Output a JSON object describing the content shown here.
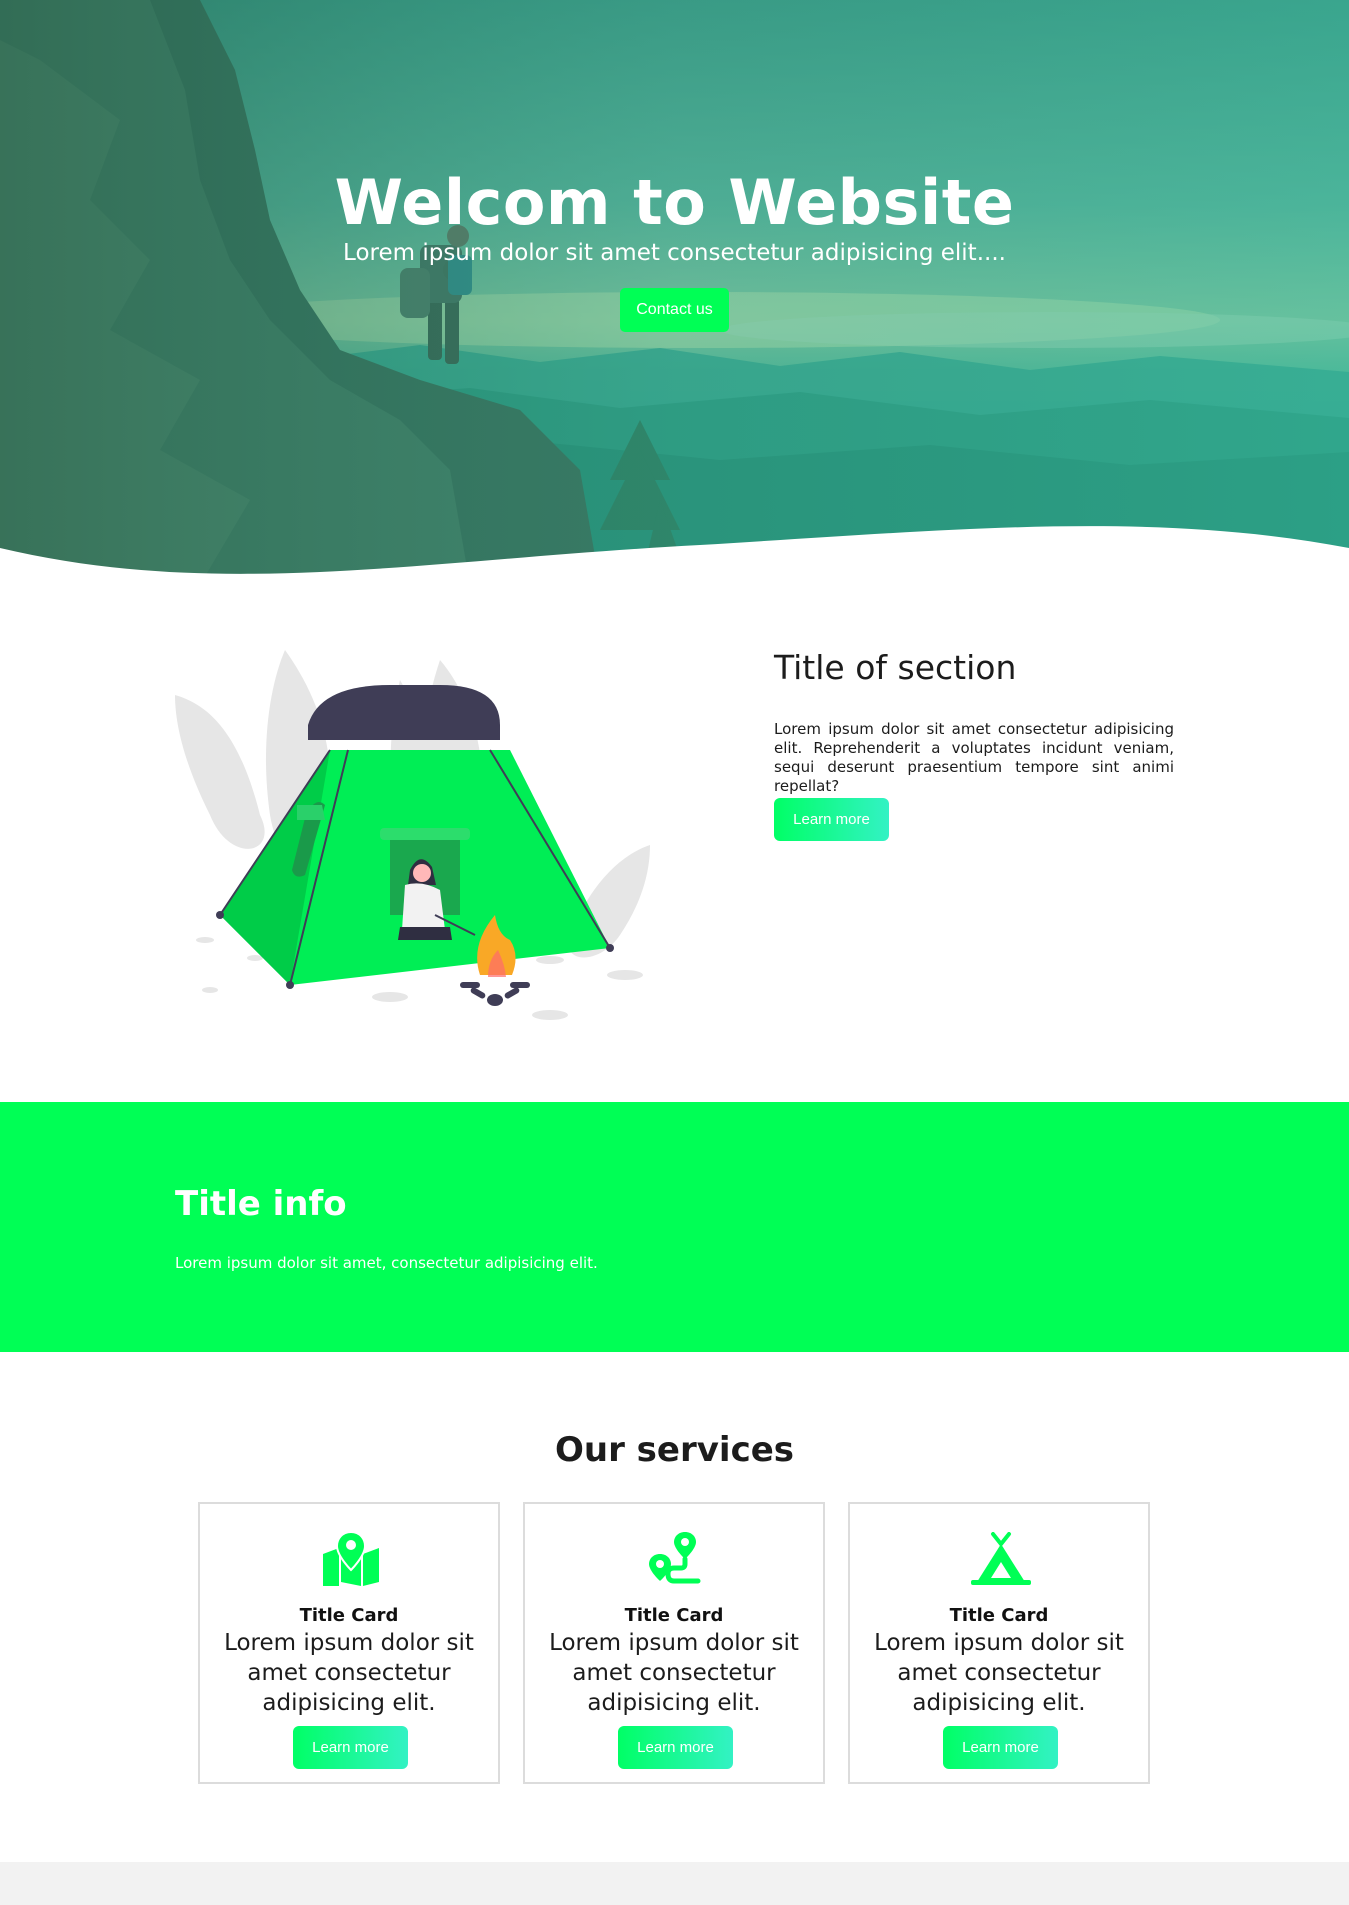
{
  "hero": {
    "title": "Welcom to Website",
    "subtitle": "Lorem ipsum dolor sit amet consectetur adipisicing elit....",
    "cta_label": "Contact us"
  },
  "about": {
    "title": "Title of section",
    "text": "Lorem ipsum dolor sit amet consectetur adipisicing elit. Reprehenderit a voluptates incidunt veniam, sequi deserunt praesentium tempore sint animi repellat?",
    "button_label": "Learn more",
    "illustration": "camping-tent-campfire-illustration"
  },
  "info": {
    "title": "Title info",
    "text": "Lorem ipsum dolor sit amet, consectetur adipisicing elit."
  },
  "services": {
    "title": "Our services",
    "cards": [
      {
        "icon": "map-location-icon",
        "title": "Title Card",
        "text": "Lorem ipsum dolor sit amet consectetur adipisicing elit.",
        "button_label": "Learn more"
      },
      {
        "icon": "route-icon",
        "title": "Title Card",
        "text": "Lorem ipsum dolor sit amet consectetur adipisicing elit.",
        "button_label": "Learn more"
      },
      {
        "icon": "tent-icon",
        "title": "Title Card",
        "text": "Lorem ipsum dolor sit amet consectetur adipisicing elit.",
        "button_label": "Learn more"
      }
    ]
  },
  "colors": {
    "accent": "#00ff55",
    "accent_gradient_end": "#33f2c4",
    "hero_overlay": "#2fb596",
    "footer_bg": "#f2f2f2"
  }
}
